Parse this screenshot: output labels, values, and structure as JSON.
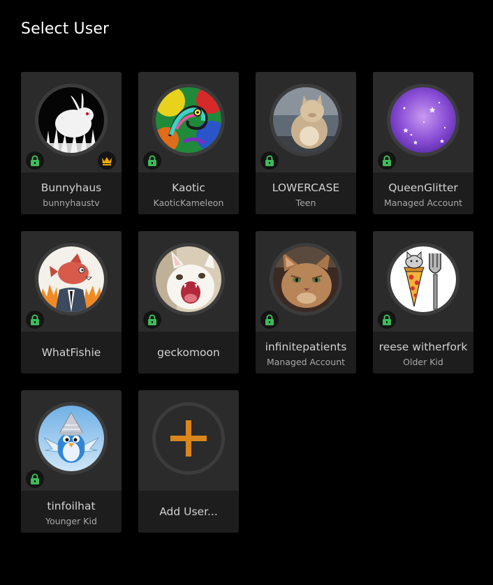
{
  "page": {
    "title": "Select User"
  },
  "colors": {
    "background": "#000000",
    "card": "#2a2a2a",
    "card_footer": "#1d1d1d",
    "lock_green": "#3dbb5a",
    "crown_gold": "#f2a900",
    "add_orange": "#d9861c"
  },
  "users": [
    {
      "name": "Bunnyhaus",
      "subtitle": "bunnyhaustv",
      "avatar": "white-rabbit-avatar",
      "locked": true,
      "owner_crown": true
    },
    {
      "name": "Kaotic",
      "subtitle": "KaoticKameleon",
      "avatar": "chameleon-avatar",
      "locked": true
    },
    {
      "name": "LOWERCASE",
      "subtitle": "Teen",
      "avatar": "fluffy-cat-avatar",
      "locked": true
    },
    {
      "name": "QueenGlitter",
      "subtitle": "Managed Account",
      "avatar": "purple-stars-avatar",
      "locked": true
    },
    {
      "name": "WhatFishie",
      "subtitle": "",
      "avatar": "fish-in-suit-avatar",
      "locked": true
    },
    {
      "name": "geckomoon",
      "subtitle": "",
      "avatar": "screaming-cat-avatar",
      "locked": true
    },
    {
      "name": "infinitepatients",
      "subtitle": "Managed Account",
      "avatar": "grumpy-cat-avatar",
      "locked": true
    },
    {
      "name": "reese witherfork",
      "subtitle": "Older Kid",
      "avatar": "cat-pizza-fork-avatar",
      "locked": true
    },
    {
      "name": "tinfoilhat",
      "subtitle": "Younger Kid",
      "avatar": "bird-tinfoil-hat-avatar",
      "locked": true
    }
  ],
  "add_user": {
    "label": "Add User...",
    "icon": "plus-icon"
  }
}
